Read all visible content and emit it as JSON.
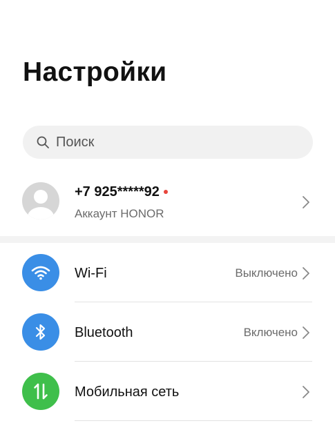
{
  "header": {
    "title": "Настройки"
  },
  "search": {
    "placeholder": "Поиск"
  },
  "account": {
    "phone": "+7 925*****92",
    "subtitle": "Аккаунт HONOR"
  },
  "settings": [
    {
      "label": "Wi-Fi",
      "value": "Выключено",
      "icon": "wifi-icon",
      "color": "#3a8ee6"
    },
    {
      "label": "Bluetooth",
      "value": "Включено",
      "icon": "bluetooth-icon",
      "color": "#3a8ee6"
    },
    {
      "label": "Мобильная сеть",
      "value": "",
      "icon": "mobile-network-icon",
      "color": "#3fbf4b"
    }
  ]
}
